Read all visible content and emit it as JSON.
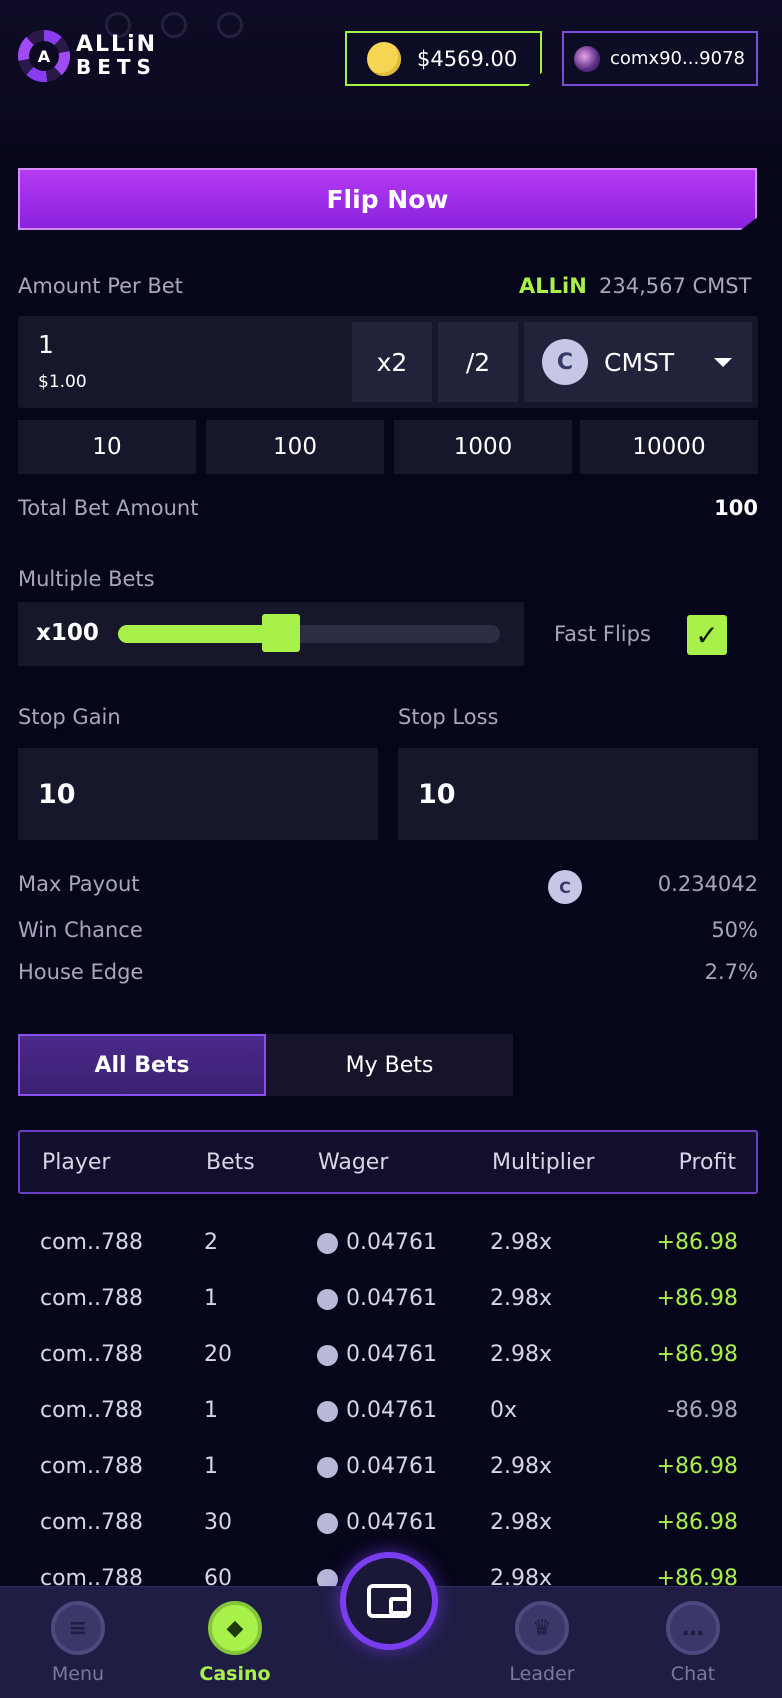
{
  "header": {
    "logo_top": "ALLiN",
    "logo_bottom": "BETS",
    "balance": "$4569.00",
    "account": "comx90...9078"
  },
  "flip_button": "Flip Now",
  "amount": {
    "label": "Amount Per Bet",
    "brand": "ALLiN",
    "holding": "234,567 CMST",
    "value": "1",
    "usd": "$1.00",
    "double_label": "x2",
    "half_label": "/2",
    "currency": "CMST",
    "quick": [
      "10",
      "100",
      "1000",
      "10000"
    ]
  },
  "total_bet": {
    "label": "Total Bet Amount",
    "value": "100"
  },
  "multiple_bets": {
    "label": "Multiple Bets",
    "value": "x100",
    "level": 0.4
  },
  "fast_flips": {
    "label": "Fast Flips",
    "checked": true
  },
  "stop_gain": {
    "label": "Stop Gain",
    "value": "10"
  },
  "stop_loss": {
    "label": "Stop Loss",
    "value": "10"
  },
  "info": {
    "max_payout_label": "Max Payout",
    "max_payout": "0.234042",
    "win_chance_label": "Win Chance",
    "win_chance": "50%",
    "house_edge_label": "House Edge",
    "house_edge": "2.7%"
  },
  "tabs": {
    "all": "All Bets",
    "mine": "My Bets"
  },
  "table": {
    "headers": [
      "Player",
      "Bets",
      "Wager",
      "Multiplier",
      "Profit"
    ],
    "rows": [
      {
        "player": "com..788",
        "bets": "2",
        "wager": "0.04761",
        "multiplier": "2.98x",
        "profit": "+86.98",
        "positive": true
      },
      {
        "player": "com..788",
        "bets": "1",
        "wager": "0.04761",
        "multiplier": "2.98x",
        "profit": "+86.98",
        "positive": true
      },
      {
        "player": "com..788",
        "bets": "20",
        "wager": "0.04761",
        "multiplier": "2.98x",
        "profit": "+86.98",
        "positive": true
      },
      {
        "player": "com..788",
        "bets": "1",
        "wager": "0.04761",
        "multiplier": "0x",
        "profit": "-86.98",
        "positive": false
      },
      {
        "player": "com..788",
        "bets": "1",
        "wager": "0.04761",
        "multiplier": "2.98x",
        "profit": "+86.98",
        "positive": true
      },
      {
        "player": "com..788",
        "bets": "30",
        "wager": "0.04761",
        "multiplier": "2.98x",
        "profit": "+86.98",
        "positive": true
      },
      {
        "player": "com..788",
        "bets": "60",
        "wager": "",
        "multiplier": "2.98x",
        "profit": "+86.98",
        "positive": true
      }
    ]
  },
  "nav": {
    "menu": "Menu",
    "casino": "Casino",
    "leader": "Leader",
    "chat": "Chat"
  },
  "colors": {
    "accent_green": "#a8f04a",
    "accent_purple": "#9a2ee8",
    "background": "#06061a"
  }
}
